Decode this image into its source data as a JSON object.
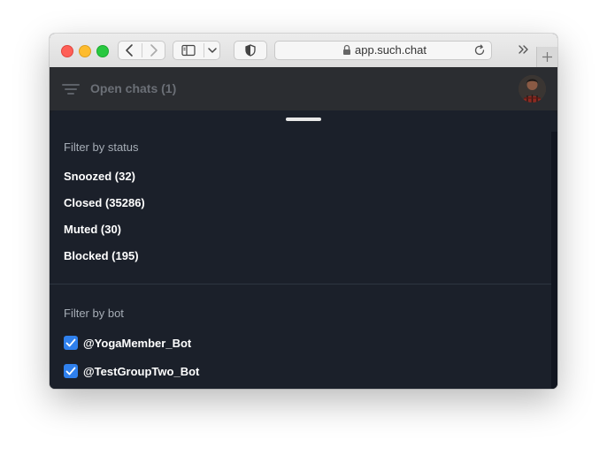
{
  "browser": {
    "url": "app.such.chat"
  },
  "appbar": {
    "title": "Open chats (1)"
  },
  "filters": {
    "status_label": "Filter by status",
    "status_items": [
      {
        "label": "Snoozed (32)"
      },
      {
        "label": "Closed (35286)"
      },
      {
        "label": "Muted (30)"
      },
      {
        "label": "Blocked (195)"
      }
    ],
    "bot_label": "Filter by bot",
    "bots": [
      {
        "label": "@YogaMember_Bot",
        "checked": true
      },
      {
        "label": "@TestGroupTwo_Bot",
        "checked": true
      }
    ]
  },
  "colors": {
    "accent": "#2f80ed",
    "sheet_bg": "#1b202a",
    "appbar_bg": "#2b2d31"
  },
  "icons": [
    "back-icon",
    "forward-icon",
    "sidebar-icon",
    "chevron-down-icon",
    "shield-icon",
    "lock-icon",
    "reload-icon",
    "more-icon",
    "plus-icon",
    "filter-icon",
    "checkbox-checked-icon"
  ]
}
